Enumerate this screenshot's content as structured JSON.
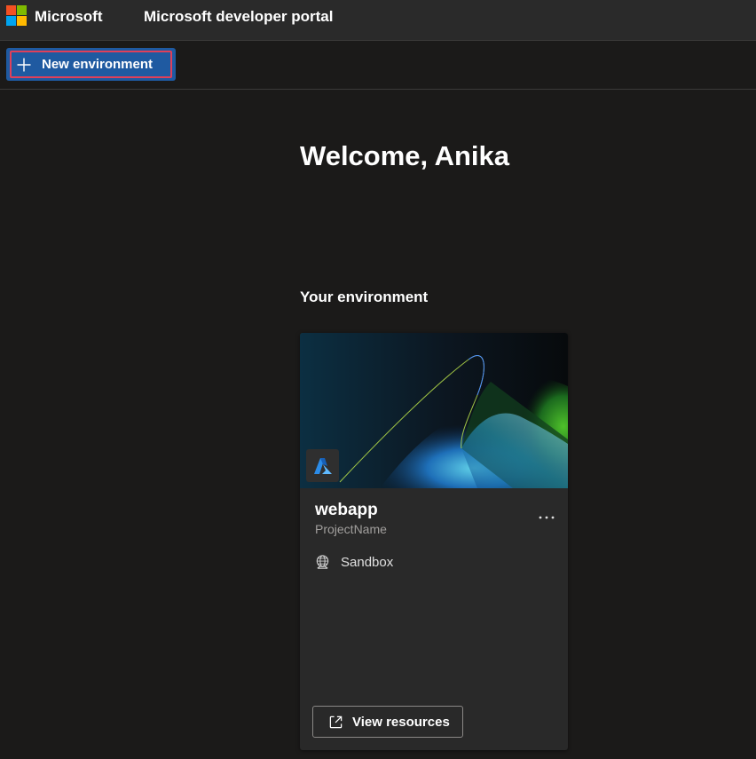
{
  "header": {
    "brand": "Microsoft",
    "portal_title": "Microsoft developer portal",
    "logo_icon": "microsoft-logo-icon",
    "logo_colors": [
      "#f25022",
      "#7fba00",
      "#00a4ef",
      "#ffb900"
    ]
  },
  "toolbar": {
    "new_environment_label": "New environment",
    "new_environment_icon": "plus-icon",
    "accent": "#1f5aa1",
    "highlight": "#e0405a"
  },
  "main": {
    "welcome": "Welcome, Anika",
    "section_title": "Your environment"
  },
  "card": {
    "name": "webapp",
    "project": "ProjectName",
    "type": "Sandbox",
    "type_icon": "globe-icon",
    "badge_icon": "azure-icon",
    "more_icon": "more-ellipsis-icon",
    "view_resources_label": "View resources",
    "view_resources_icon": "external-link-icon"
  }
}
